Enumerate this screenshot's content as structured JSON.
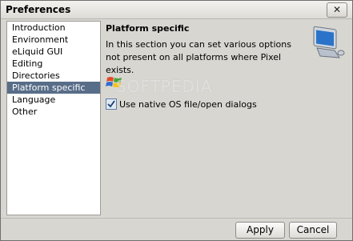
{
  "window": {
    "title": "Preferences",
    "close_label": "✕"
  },
  "sidebar": {
    "items": [
      {
        "label": "Introduction",
        "selected": false
      },
      {
        "label": "Environment",
        "selected": false
      },
      {
        "label": "eLiquid GUI",
        "selected": false
      },
      {
        "label": "Editing",
        "selected": false
      },
      {
        "label": "Directories",
        "selected": false
      },
      {
        "label": "Platform specific",
        "selected": true
      },
      {
        "label": "Language",
        "selected": false
      },
      {
        "label": "Other",
        "selected": false
      }
    ]
  },
  "main": {
    "heading": "Platform specific",
    "description": "In this section you can set various options not present on all platforms where Pixel exists.",
    "watermark": "SOFTPEDIA",
    "native_dialogs": {
      "label": "Use native OS file/open dialogs",
      "checked": true
    }
  },
  "footer": {
    "apply_label": "Apply",
    "cancel_label": "Cancel"
  }
}
